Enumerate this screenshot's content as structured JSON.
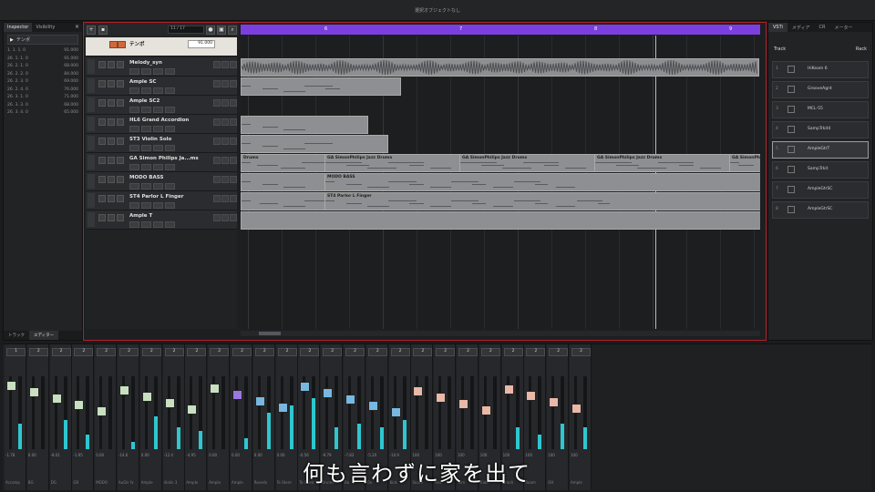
{
  "window": {
    "title": "選択オブジェクトなし"
  },
  "inspector": {
    "tabs": [
      "Inspector",
      "Visibility"
    ],
    "close_label": "×",
    "section_label": "テンポ",
    "rows": [
      [
        "1. 1. 1. 0",
        "91.000"
      ],
      [
        "26. 1. 1. 0",
        "91.000"
      ],
      [
        "26. 2. 1. 0",
        "68.000"
      ],
      [
        "26. 2. 2. 0",
        "84.000"
      ],
      [
        "26. 2. 3. 0",
        "69.000"
      ],
      [
        "26. 2. 4. 0",
        "76.000"
      ],
      [
        "26. 3. 1. 0",
        "71.000"
      ],
      [
        "26. 3. 3. 0",
        "68.000"
      ],
      [
        "26. 3. 4. 0",
        "65.000"
      ]
    ],
    "bottom_tabs": [
      "トラック",
      "エディター"
    ]
  },
  "project": {
    "toolbar_field": "11 / 17",
    "ruler": [
      "6",
      "7",
      "8",
      "9"
    ],
    "tempo_track": {
      "name": "テンポ",
      "value": "91.000"
    },
    "tracks": [
      {
        "name": "Melody_syn"
      },
      {
        "name": "Ample SC"
      },
      {
        "name": "Ample SC2"
      },
      {
        "name": "HL6 Grand Accordion"
      },
      {
        "name": "ST3 Violin Solo"
      },
      {
        "name": "GA Simon Philips Ja...ms"
      },
      {
        "name": "MODO BASS"
      },
      {
        "name": "ST4 Parlor L Finger"
      },
      {
        "name": "Ample T"
      }
    ],
    "parts": [
      {
        "label": "Drums"
      },
      {
        "label": "GA SimonPhilips Jazz Drums"
      },
      {
        "label": "GA SimonPhilips Jazz Drums"
      },
      {
        "label": "GA SimonPhilips Jazz Drums"
      },
      {
        "label": "GA SimonPh"
      },
      {
        "label": "MODO BASS"
      },
      {
        "label": "ST4 Parlor L Finger"
      }
    ]
  },
  "rightzone": {
    "tabs": [
      "VSTi",
      "メディア",
      "CR",
      "メーター"
    ],
    "track_label": "Track",
    "rack_label": "Rack",
    "instruments": [
      {
        "index": "1",
        "name": "HiKeam 6"
      },
      {
        "index": "2",
        "name": "GrooveAgnt"
      },
      {
        "index": "3",
        "name": "MCL-55"
      },
      {
        "index": "4",
        "name": "SampTrkit4"
      },
      {
        "index": "5",
        "name": "AmpleGtrT"
      },
      {
        "index": "6",
        "name": "SampTrkit"
      },
      {
        "index": "7",
        "name": "AmpleGtrSC"
      },
      {
        "index": "8",
        "name": "AmpleGtrSC"
      }
    ]
  },
  "mixer": {
    "channels": [
      {
        "top": "1",
        "vol": "-1.78",
        "name": "Accomp",
        "color": "#c8e0c0",
        "level": 0.35
      },
      {
        "top": "2",
        "vol": "0.00",
        "name": "BG",
        "color": "#c8e0c0",
        "level": 0.0
      },
      {
        "top": "2",
        "vol": "-8.01",
        "name": "DG",
        "color": "#c8e0c0",
        "level": 0.4
      },
      {
        "top": "2",
        "vol": "-1.95",
        "name": "GR",
        "color": "#c8e0c0",
        "level": 0.2
      },
      {
        "top": "2",
        "vol": "0.00",
        "name": "MODO",
        "color": "#c8e0c0",
        "level": 0.0
      },
      {
        "top": "2",
        "vol": "-14.6",
        "name": "AuGtr fx",
        "color": "#c8e0c0",
        "level": 0.1
      },
      {
        "top": "2",
        "vol": "0.00",
        "name": "Ample",
        "color": "#c8e0c0",
        "level": 0.45
      },
      {
        "top": "2",
        "vol": "-12.4",
        "name": "Violin 3",
        "color": "#c8e0c0",
        "level": 0.3
      },
      {
        "top": "2",
        "vol": "-4.95",
        "name": "Ample",
        "color": "#c8e0c0",
        "level": 0.25
      },
      {
        "top": "2",
        "vol": "0.00",
        "name": "Ample",
        "color": "#c8e0c0",
        "level": 0.0
      },
      {
        "top": "2",
        "vol": "0.00",
        "name": "Ample",
        "color": "#9a78e0",
        "level": 0.15
      },
      {
        "top": "2",
        "vol": "0.00",
        "name": "Reverb",
        "color": "#78b8e0",
        "level": 0.5
      },
      {
        "top": "2",
        "vol": "0.00",
        "name": "Te Stere",
        "color": "#78b8e0",
        "level": 0.6
      },
      {
        "top": "2",
        "vol": "-0.56",
        "name": "Te Stere",
        "color": "#78b8e0",
        "level": 0.7
      },
      {
        "top": "2",
        "vol": "-9.79",
        "name": "Drums",
        "color": "#78b8e0",
        "level": 0.3
      },
      {
        "top": "2",
        "vol": "-7.83",
        "name": "Ba",
        "color": "#78b8e0",
        "level": 0.35
      },
      {
        "top": "2",
        "vol": "-5.20",
        "name": "Ov",
        "color": "#78b8e0",
        "level": 0.3
      },
      {
        "top": "2",
        "vol": "-10.9",
        "name": "Kick",
        "color": "#78b8e0",
        "level": 0.4
      },
      {
        "top": "2",
        "vol": "100",
        "name": "Snare",
        "color": "#e8b8a8",
        "level": 0.0
      },
      {
        "top": "2",
        "vol": "100",
        "name": "Hat",
        "color": "#e8b8a8",
        "level": 0.0
      },
      {
        "top": "2",
        "vol": "100",
        "name": "Tom",
        "color": "#e8b8a8",
        "level": 0.0
      },
      {
        "top": "2",
        "vol": "100",
        "name": "Ride",
        "color": "#e8b8a8",
        "level": 0.0
      },
      {
        "top": "2",
        "vol": "100",
        "name": "Crash",
        "color": "#e8b8a8",
        "level": 0.3
      },
      {
        "top": "2",
        "vol": "100",
        "name": "Room",
        "color": "#e8b8a8",
        "level": 0.2
      },
      {
        "top": "2",
        "vol": "100",
        "name": "OH",
        "color": "#e8b8a8",
        "level": 0.35
      },
      {
        "top": "2",
        "vol": "100",
        "name": "Ample",
        "color": "#e8b8a8",
        "level": 0.3
      }
    ]
  },
  "subtitle": "何も言わずに家を出て"
}
